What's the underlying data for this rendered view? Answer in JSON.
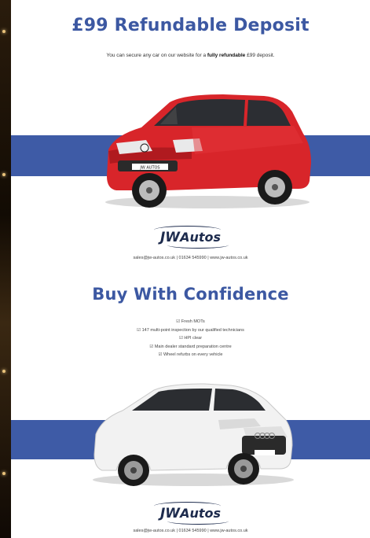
{
  "section1": {
    "title": "£99 Refundable Deposit",
    "subtitle_pre": "You can secure any car on our website for a ",
    "subtitle_bold1": "fully refundable",
    "subtitle_mid": " £99 deposit.",
    "car_plate": "JW AUTOS"
  },
  "logo": {
    "jw": "JW",
    "autos": "Autos"
  },
  "contact_line1": "sales@jw-autos.co.uk | 01634 545990 | www.jw-autos.co.uk",
  "section2": {
    "title": "Buy With Confidence",
    "bullets": [
      "Fresh MOTs",
      "147 multi-point inspection by our qualified technicians",
      "HPI clear",
      "Main dealer standard preparation centre",
      "Wheel refurbs on every vehicle"
    ],
    "bullet_marker": "☑"
  },
  "contact_line2": "sales@jw-autos.co.uk | 01634 545990 | www.jw-autos.co.uk",
  "colors": {
    "brand_blue": "#3e5ba6",
    "title_blue": "#3c58a2",
    "red_car": "#d8252a",
    "white_car": "#f2f2f2"
  }
}
